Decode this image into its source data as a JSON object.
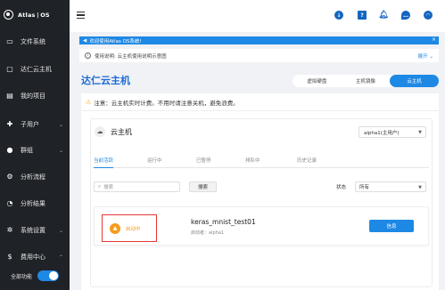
{
  "sidebar": {
    "logo": "Atlas | OS",
    "items": [
      {
        "label": "文件系统",
        "icon": "folder-icon"
      },
      {
        "label": "达仁云主机",
        "icon": "monitor-icon"
      },
      {
        "label": "我的项目",
        "icon": "book-icon"
      },
      {
        "label": "子用户",
        "icon": "user-add-icon"
      },
      {
        "label": "群组",
        "icon": "group-icon"
      },
      {
        "label": "分析流程",
        "icon": "flow-icon"
      },
      {
        "label": "分析结果",
        "icon": "pie-chart-icon"
      },
      {
        "label": "系统设置",
        "icon": "gear-icon"
      },
      {
        "label": "费用中心",
        "icon": "billing-icon"
      }
    ],
    "toggle_label": "全部功能"
  },
  "banner": {
    "text": "欢迎使用Atlas OS系统!"
  },
  "explain": {
    "text": "使用说明:  云主机使用说明示意图",
    "expand": "展开"
  },
  "page_title": "达仁云主机",
  "view_tabs": [
    "虚拟硬盘",
    "主机镜像",
    "云主机"
  ],
  "notice": "注意：云主机实时计费。不用时请注意关机，避免浪费。",
  "section_title": "云主机",
  "owner_select": "alpha1(主用户)",
  "subtabs": [
    "当前活跃",
    "运行中",
    "已暂停",
    "排队中",
    "历史记录"
  ],
  "search": {
    "placeholder": "搜索",
    "button": "搜索"
  },
  "status_filter": {
    "label": "状态",
    "value": "所有"
  },
  "instance": {
    "status": "启动中",
    "name": "keras_mnist_test01",
    "starter": "启动者：alpha1",
    "info_button": "信息"
  },
  "colors": {
    "accent": "#1e88e5",
    "sidebar": "#1f2227",
    "warning": "#f59c1a",
    "highlight": "#e53935"
  }
}
